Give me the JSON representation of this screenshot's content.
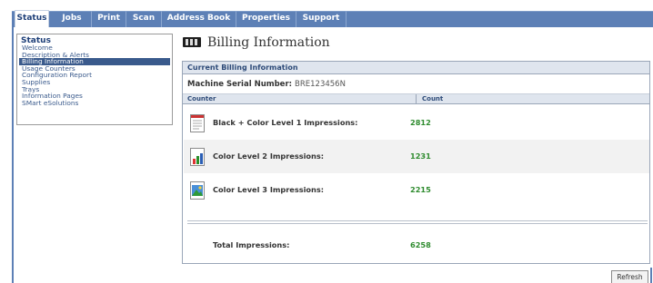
{
  "nav": {
    "tabs": [
      {
        "label": "Status",
        "active": true
      },
      {
        "label": "Jobs"
      },
      {
        "label": "Print"
      },
      {
        "label": "Scan"
      },
      {
        "label": "Address Book"
      },
      {
        "label": "Properties"
      },
      {
        "label": "Support"
      }
    ]
  },
  "sidebar": {
    "heading": "Status",
    "items": [
      {
        "label": "Welcome"
      },
      {
        "label": "Description & Alerts"
      },
      {
        "label": "Billing Information",
        "selected": true
      },
      {
        "label": "Usage Counters"
      },
      {
        "label": "Configuration Report"
      },
      {
        "label": "Supplies"
      },
      {
        "label": "Trays"
      },
      {
        "label": "Information Pages"
      },
      {
        "label": "SMart eSolutions"
      }
    ]
  },
  "main": {
    "title": "Billing Information",
    "panel_title": "Current Billing Information",
    "serial_label": "Machine Serial Number:",
    "serial_value": "BRE123456N",
    "col_counter": "Counter",
    "col_count": "Count",
    "rows": [
      {
        "label": "Black + Color Level 1 Impressions:",
        "count": "2812",
        "icon": "document-icon"
      },
      {
        "label": "Color Level 2 Impressions:",
        "count": "1231",
        "icon": "bar-chart-icon"
      },
      {
        "label": "Color Level 3 Impressions:",
        "count": "2215",
        "icon": "image-icon"
      }
    ],
    "total_label": "Total Impressions:",
    "total_value": "6258"
  },
  "actions": {
    "refresh_label": "Refresh"
  },
  "colors": {
    "nav_blue": "#5d80b6",
    "count_green": "#2e8b2e",
    "header_bg": "#dfe5ee"
  }
}
